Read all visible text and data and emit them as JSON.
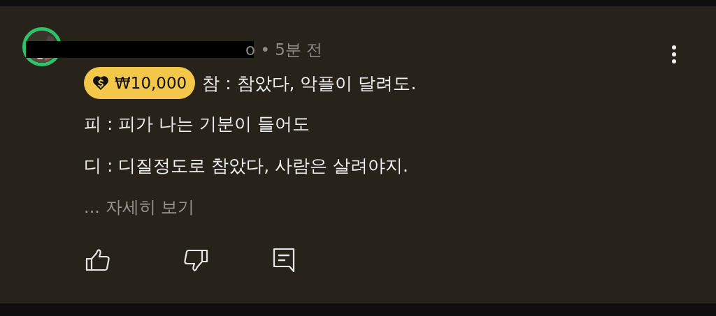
{
  "comment": {
    "meta": "o • 5분 전",
    "amount": "₩10,000",
    "lines": [
      "참 : 참았다, 악플이 달려도.",
      "피 : 피가 나는 기분이 들어도",
      "디 : 디질정도로 참았다, 사람은 살려야지."
    ],
    "more": "... 자세히 보기"
  }
}
